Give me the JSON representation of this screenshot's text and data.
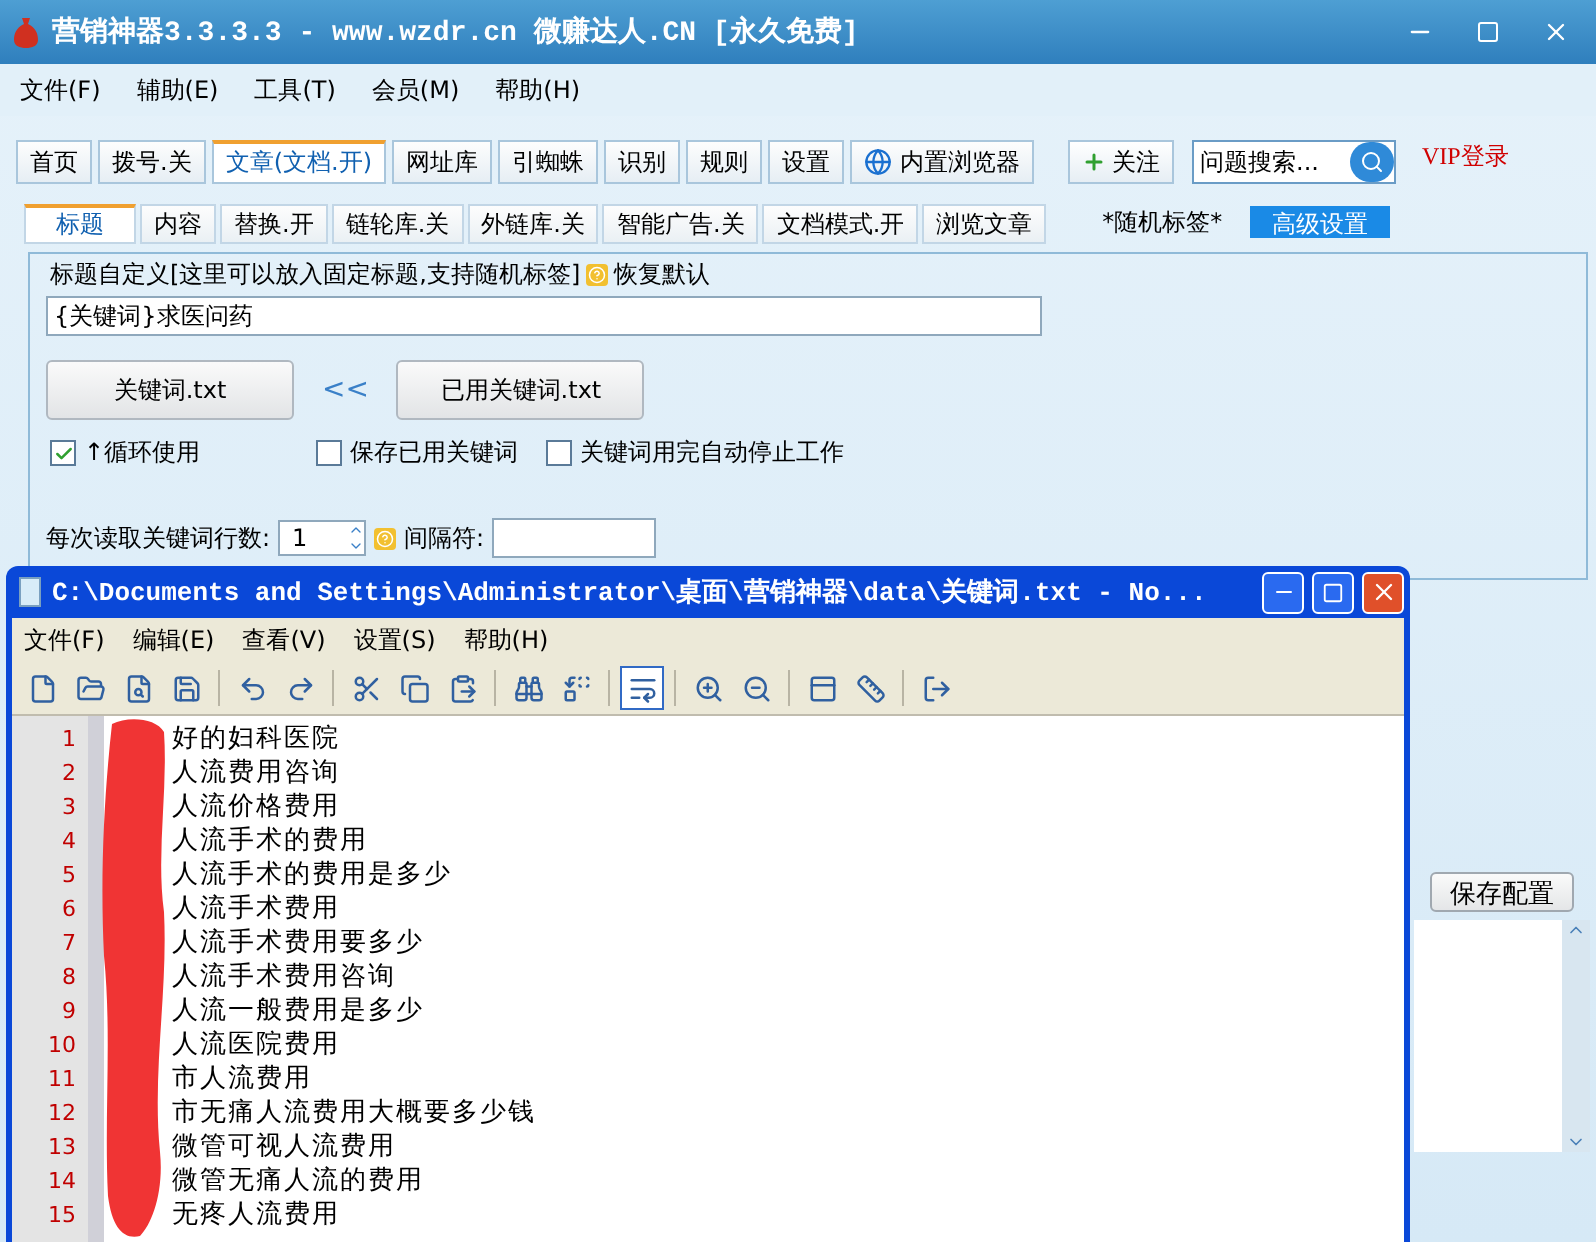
{
  "window": {
    "title": "营销神器3.3.3.3 - www.wzdr.cn 微赚达人.CN [永久免费]"
  },
  "menu": [
    "文件(F)",
    "辅助(E)",
    "工具(T)",
    "会员(M)",
    "帮助(H)"
  ],
  "tabs": [
    {
      "label": "首页",
      "selected": false,
      "kind": "plain"
    },
    {
      "label": "拨号.关",
      "selected": false,
      "kind": "plain"
    },
    {
      "label": "文章(文档.开)",
      "selected": true,
      "kind": "plain"
    },
    {
      "label": "网址库",
      "selected": false,
      "kind": "plain"
    },
    {
      "label": "引蜘蛛",
      "selected": false,
      "kind": "plain"
    },
    {
      "label": "识别",
      "selected": false,
      "kind": "plain"
    },
    {
      "label": "规则",
      "selected": false,
      "kind": "plain"
    },
    {
      "label": "设置",
      "selected": false,
      "kind": "plain"
    },
    {
      "label": "内置浏览器",
      "selected": false,
      "kind": "browser"
    }
  ],
  "follow_button": "关注",
  "search": {
    "value": "问题搜索..."
  },
  "vip_link": "VIP登录",
  "subtabs": [
    {
      "label": "标题",
      "selected": true
    },
    {
      "label": "内容",
      "selected": false
    },
    {
      "label": "替换.开",
      "selected": false
    },
    {
      "label": "链轮库.关",
      "selected": false
    },
    {
      "label": "外链库.关",
      "selected": false
    },
    {
      "label": "智能广告.关",
      "selected": false
    },
    {
      "label": "文档模式.开",
      "selected": false
    },
    {
      "label": "浏览文章",
      "selected": false
    }
  ],
  "random_tag": "*随机标签*",
  "advanced_settings": "高级设置",
  "title_group": {
    "legend": "标题自定义[这里可以放入固定标题,支持随机标签]",
    "restore_default": "恢复默认",
    "title_input": "{关键词}求医问药",
    "keyword_button": "关键词.txt",
    "arrow": "<<",
    "used_button": "已用关键词.txt",
    "options": [
      {
        "label": "↑循环使用",
        "checked": true
      },
      {
        "label": "保存已用关键词",
        "checked": false
      },
      {
        "label": "关键词用完自动停止工作",
        "checked": false
      }
    ],
    "lines_label": "每次读取关键词行数:",
    "lines_value": "1",
    "separator_label": "间隔符:"
  },
  "save_config": "保存配置",
  "notepad": {
    "title": "C:\\Documents and Settings\\Administrator\\桌面\\营销神器\\data\\关键词.txt - No...",
    "menu": [
      "文件(F)",
      "编辑(E)",
      "查看(V)",
      "设置(S)",
      "帮助(H)"
    ],
    "word_wrap": true,
    "lines": [
      {
        "number": "1",
        "text": "好的妇科医院"
      },
      {
        "number": "2",
        "text": "人流费用咨询"
      },
      {
        "number": "3",
        "text": "人流价格费用"
      },
      {
        "number": "4",
        "text": "人流手术的费用"
      },
      {
        "number": "5",
        "text": "人流手术的费用是多少"
      },
      {
        "number": "6",
        "text": "人流手术费用"
      },
      {
        "number": "7",
        "text": "人流手术费用要多少"
      },
      {
        "number": "8",
        "text": "人流手术费用咨询"
      },
      {
        "number": "9",
        "text": "人流一般费用是多少"
      },
      {
        "number": "10",
        "text": "人流医院费用"
      },
      {
        "number": "11",
        "text": "市人流费用"
      },
      {
        "number": "12",
        "text": "市无痛人流费用大概要多少钱"
      },
      {
        "number": "13",
        "text": "微管可视人流费用"
      },
      {
        "number": "14",
        "text": "微管无痛人流的费用"
      },
      {
        "number": "15",
        "text": "无疼人流费用"
      }
    ]
  }
}
